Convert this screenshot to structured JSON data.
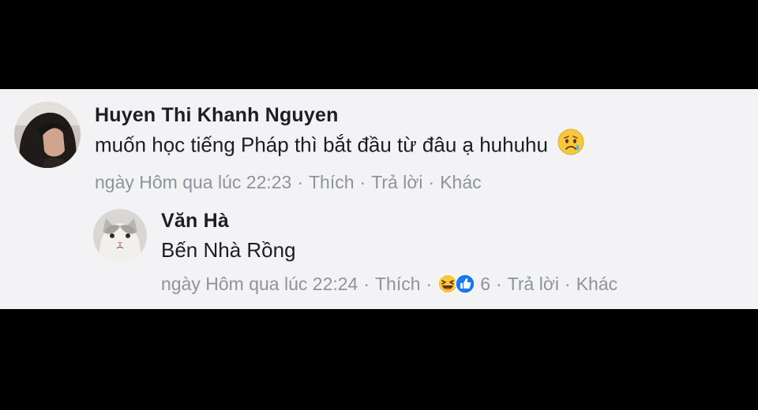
{
  "comments": [
    {
      "author": "Huyen Thi Khanh Nguyen",
      "text": "muốn học tiếng Pháp thì bắt đầu từ đâu ạ huhuhu",
      "text_emoji": "sad-tear-emoji",
      "timestamp": "ngày Hôm qua lúc 22:23",
      "like_label": "Thích",
      "reply_label": "Trả lời",
      "more_label": "Khác",
      "separator": "·"
    },
    {
      "author": "Văn Hà",
      "text": "Bến Nhà Rồng",
      "timestamp": "ngày Hôm qua lúc 22:24",
      "like_label": "Thích",
      "reaction_count": "6",
      "reactions": [
        "haha-reaction",
        "like-reaction"
      ],
      "reply_label": "Trả lời",
      "more_label": "Khác",
      "separator": "·"
    }
  ],
  "colors": {
    "background": "#000000",
    "panel": "#f3f3f5",
    "text": "#1c1e21",
    "meta": "#8d949e",
    "like_blue": "#1877f2",
    "emoji_yellow": "#f7c73c"
  }
}
